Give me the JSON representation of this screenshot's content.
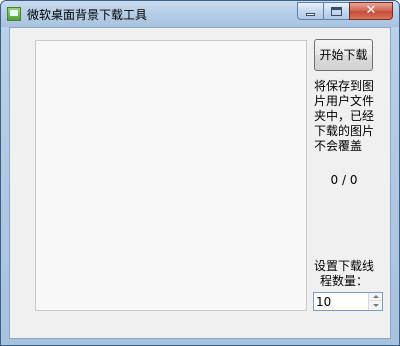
{
  "window": {
    "title": "微软桌面背景下载工具",
    "close_glyph": "✕"
  },
  "toolbar": {
    "start_label": "开始下载"
  },
  "info": {
    "save_note": "将保存到图片用户文件夹中，已经下载的图片不会覆盖",
    "progress": "0 / 0"
  },
  "settings": {
    "thread_label": "设置下载线程数量：",
    "thread_count": "10"
  },
  "colors": {
    "client_bg": "#f0f0f0",
    "title_bar": "#b5cde6",
    "close_button": "#c44c37"
  },
  "icons": {
    "app": "app-icon",
    "minimize": "minimize-icon",
    "maximize": "maximize-icon",
    "close": "close-icon",
    "spin_up": "chevron-up-icon",
    "spin_down": "chevron-down-icon"
  }
}
